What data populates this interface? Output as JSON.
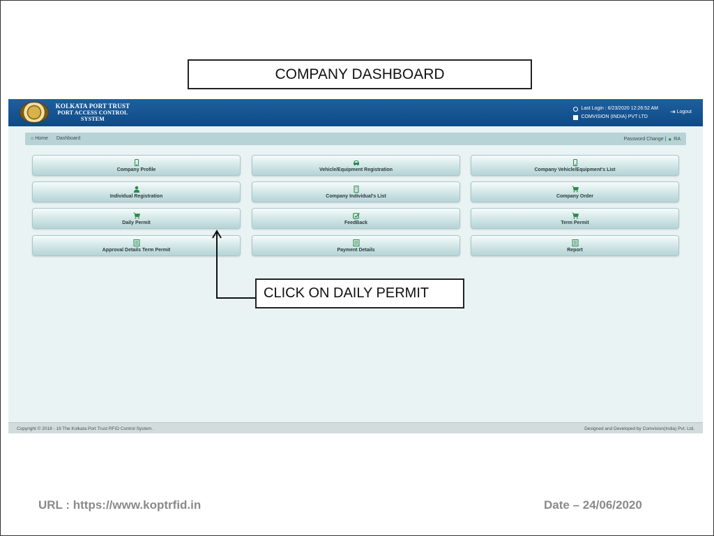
{
  "slide": {
    "title": "COMPANY DASHBOARD",
    "callout": "CLICK ON DAILY PERMIT",
    "url": "URL : https://www.koptrfid.in",
    "date": "Date – 24/06/2020"
  },
  "header": {
    "logo_line1": "KOLKATA PORT TRUST",
    "logo_line2": "PORT ACCESS CONTROL",
    "logo_line3": "SYSTEM",
    "last_login": "Last Login : 6/23/2020 12:26:52 AM",
    "company": "COMVISION (INDIA) PVT LTD",
    "logout": "Logout"
  },
  "breadcrumb": {
    "home": "Home",
    "current": "Dashboard",
    "password_change": "Password Change |",
    "user": "RA"
  },
  "tiles": [
    {
      "label": "Company Profile",
      "icon": "mobile-icon"
    },
    {
      "label": "Vehicle/Equipment Registration",
      "icon": "car-icon"
    },
    {
      "label": "Company Vehicle/Equipment's List",
      "icon": "mobile-icon"
    },
    {
      "label": "Individual Registration",
      "icon": "user-icon"
    },
    {
      "label": "Company Individual's List",
      "icon": "building-icon"
    },
    {
      "label": "Company Order",
      "icon": "cart-icon"
    },
    {
      "label": "Daily Permit",
      "icon": "cart-icon"
    },
    {
      "label": "FeedBack",
      "icon": "edit-icon"
    },
    {
      "label": "Term Permit",
      "icon": "cart-icon"
    },
    {
      "label": "Approval Details Term Permit",
      "icon": "list-icon"
    },
    {
      "label": "Payment Details",
      "icon": "list-icon"
    },
    {
      "label": "Report",
      "icon": "list-icon"
    }
  ],
  "footer": {
    "copyright": "Copyright © 2018 - 19 The Kolkata Port Trust RFID Control System.",
    "credit": "Designed and Developed by Comvision(India) Pvt. Ltd."
  },
  "colors": {
    "header": "#0e4a86",
    "icon": "#2b8a4a",
    "tile": "#cfe5e6"
  }
}
